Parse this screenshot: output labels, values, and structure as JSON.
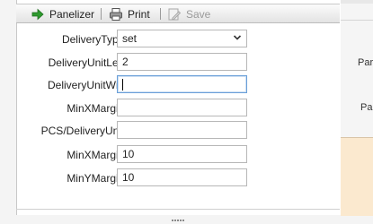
{
  "toolbar": {
    "panelizer_label": "Panelizer",
    "print_label": "Print",
    "save_label": "Save"
  },
  "form": {
    "fields": [
      {
        "label": "DeliveryType :",
        "value": "set"
      },
      {
        "label": "DeliveryUnitLen :",
        "value": "2"
      },
      {
        "label": "DeliveryUnitWid :",
        "value": ""
      },
      {
        "label": "MinXMargin :",
        "value": ""
      },
      {
        "label": "PCS/DeliveryUnit :",
        "value": ""
      },
      {
        "label": "MinXMargin :",
        "value": "10"
      },
      {
        "label": "MinYMargin :",
        "value": "10"
      }
    ]
  },
  "right_panel": {
    "label_1": "Par",
    "label_2": "Pa"
  },
  "colors": {
    "accent_green": "#2e9a2e",
    "focus_border": "#6a9fd8",
    "side_panel_fill": "#fbe9cf"
  }
}
